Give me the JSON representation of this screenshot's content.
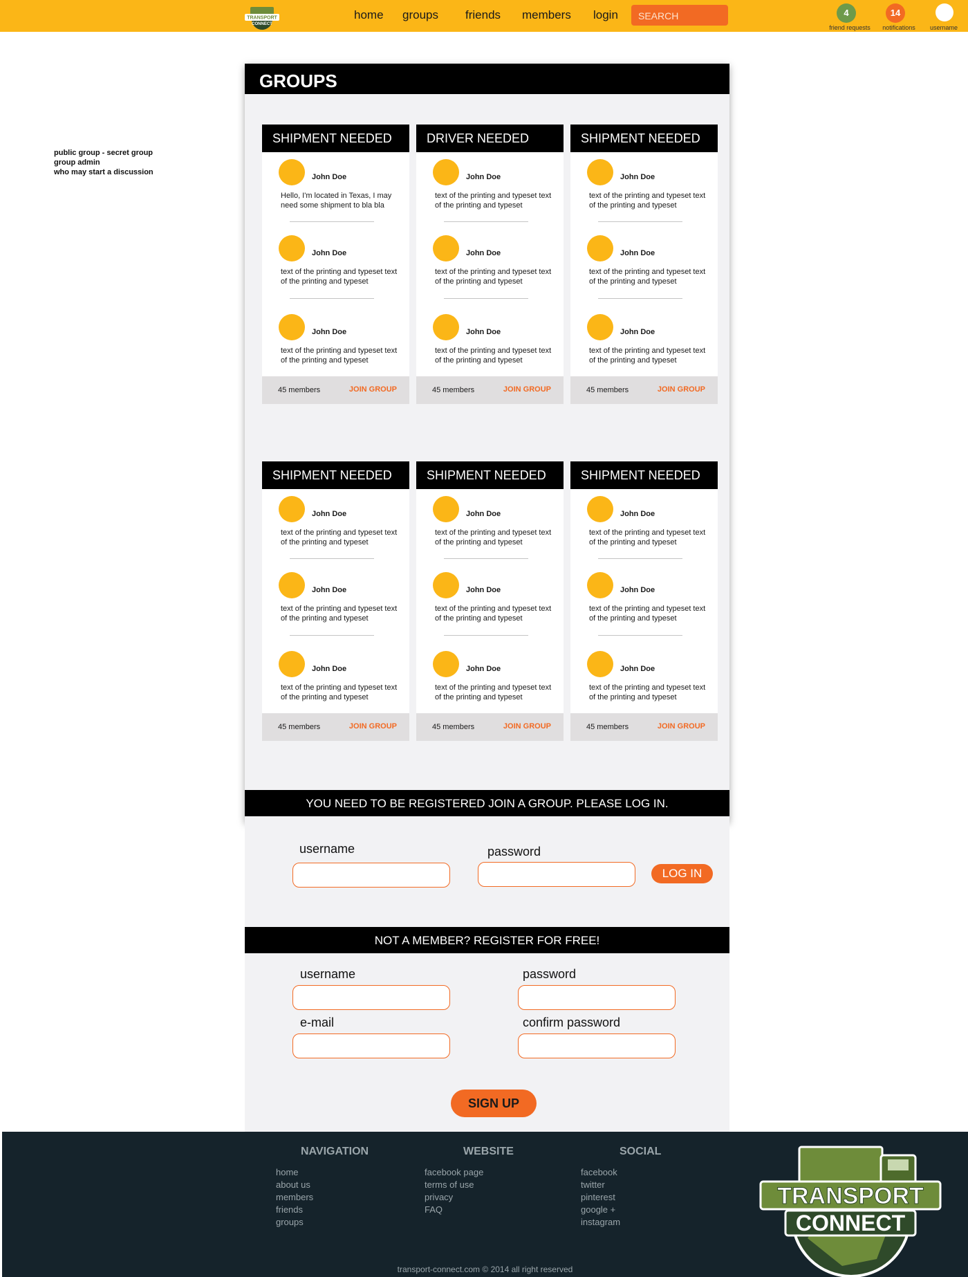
{
  "nav": {
    "links": [
      "home",
      "groups",
      "friends",
      "members",
      "login"
    ],
    "search_placeholder": "SEARCH",
    "friend_requests_count": "4",
    "friend_requests_label": "friend requests",
    "notifications_count": "14",
    "notifications_label": "notifications",
    "username_label": "username"
  },
  "side_note": [
    "public group - secret group",
    "group admin",
    "who may start a discussion"
  ],
  "groups_panel": {
    "title": "GROUPS",
    "cards": [
      {
        "title": "SHIPMENT NEEDED",
        "posts": [
          {
            "name": "John Doe",
            "text": "Hello, I'm located in Texas, I may need some shipment to bla bla"
          },
          {
            "name": "John Doe",
            "text": "text of the printing and typeset text of the printing and typeset"
          },
          {
            "name": "John Doe",
            "text": "text of the printing and typeset text of the printing and typeset"
          }
        ],
        "members": "45 members",
        "join": "JOIN GROUP"
      },
      {
        "title": "DRIVER NEEDED",
        "posts": [
          {
            "name": "John Doe",
            "text": "text of the printing and typeset text of the printing and typeset"
          },
          {
            "name": "John Doe",
            "text": "text of the printing and typeset text of the printing and typeset"
          },
          {
            "name": "John Doe",
            "text": "text of the printing and typeset text of the printing and typeset"
          }
        ],
        "members": "45 members",
        "join": "JOIN GROUP"
      },
      {
        "title": "SHIPMENT NEEDED",
        "posts": [
          {
            "name": "John Doe",
            "text": "text of the printing and typeset text of the printing and typeset"
          },
          {
            "name": "John Doe",
            "text": "text of the printing and typeset text of the printing and typeset"
          },
          {
            "name": "John Doe",
            "text": "text of the printing and typeset text of the printing and typeset"
          }
        ],
        "members": "45 members",
        "join": "JOIN GROUP"
      },
      {
        "title": "SHIPMENT NEEDED",
        "posts": [
          {
            "name": "John Doe",
            "text": "text of the printing and typeset text of the printing and typeset"
          },
          {
            "name": "John Doe",
            "text": "text of the printing and typeset text of the printing and typeset"
          },
          {
            "name": "John Doe",
            "text": "text of the printing and typeset text of the printing and typeset"
          }
        ],
        "members": "45 members",
        "join": "JOIN GROUP"
      },
      {
        "title": "SHIPMENT NEEDED",
        "posts": [
          {
            "name": "John Doe",
            "text": "text of the printing and typeset text of the printing and typeset"
          },
          {
            "name": "John Doe",
            "text": "text of the printing and typeset text of the printing and typeset"
          },
          {
            "name": "John Doe",
            "text": "text of the printing and typeset text of the printing and typeset"
          }
        ],
        "members": "45 members",
        "join": "JOIN GROUP"
      },
      {
        "title": "SHIPMENT NEEDED",
        "posts": [
          {
            "name": "John Doe",
            "text": "text of the printing and typeset text of the printing and typeset"
          },
          {
            "name": "John Doe",
            "text": "text of the printing and typeset text of the printing and typeset"
          },
          {
            "name": "John Doe",
            "text": "text of the printing and typeset text of the printing and typeset"
          }
        ],
        "members": "45 members",
        "join": "JOIN GROUP"
      }
    ]
  },
  "login_banner": "YOU NEED TO BE REGISTERED JOIN A GROUP. PLEASE LOG IN.",
  "login_form": {
    "username_label": "username",
    "password_label": "password",
    "button": "LOG IN"
  },
  "register_banner": "NOT A MEMBER? REGISTER FOR FREE!",
  "register_form": {
    "username_label": "username",
    "password_label": "password",
    "email_label": "e-mail",
    "confirm_label": "confirm password",
    "button": "SIGN UP"
  },
  "footer": {
    "navigation": {
      "title": "NAVIGATION",
      "links": [
        "home",
        "about us",
        "members",
        "friends",
        "groups"
      ]
    },
    "website": {
      "title": "WEBSITE",
      "links": [
        "facebook page",
        "terms of use",
        "privacy",
        "FAQ"
      ]
    },
    "social": {
      "title": "SOCIAL",
      "links": [
        "facebook",
        "twitter",
        "pinterest",
        "google +",
        "instagram"
      ]
    },
    "copyright": "transport-connect.com  © 2014 all right reserved"
  },
  "brand": {
    "logo_text_1": "TRANSPORT",
    "logo_text_2": "CONNECT",
    "accent": "#fbb617",
    "orange": "#f26a23",
    "dark": "#15232b",
    "logo_green": "#6e8c3a"
  }
}
